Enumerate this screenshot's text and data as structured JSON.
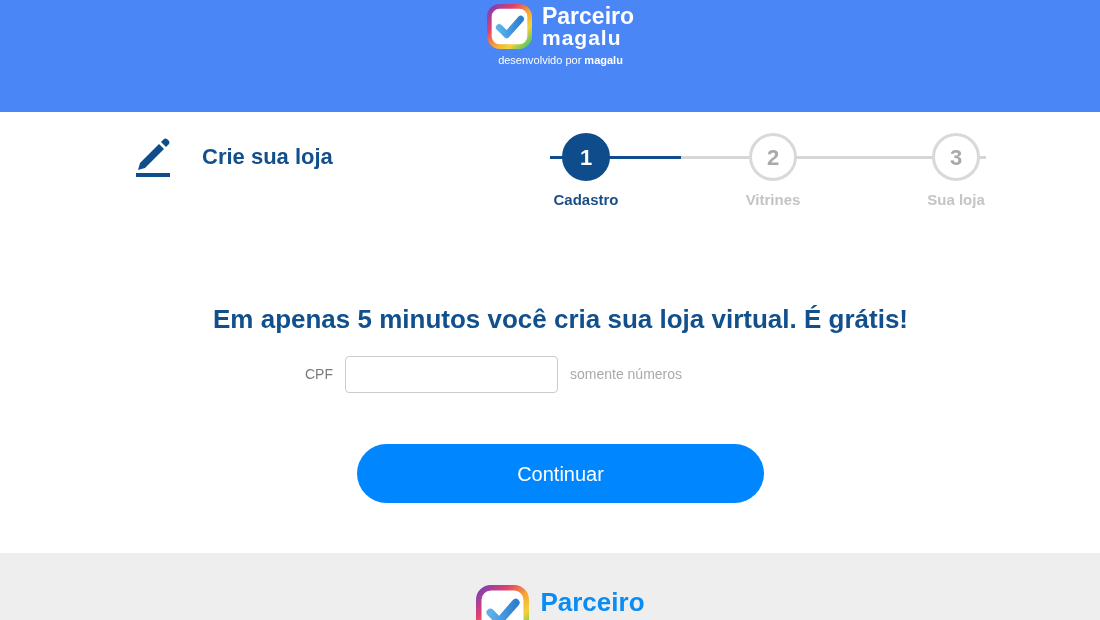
{
  "header": {
    "logo": {
      "name": "Parceiro",
      "wordmark": "magalu"
    },
    "tagline": "desenvolvido por **magalu**"
  },
  "page_title": "Crie sua loja",
  "stepper": {
    "level": 0.3,
    "steps": [
      {
        "number": "1",
        "label": "Cadastro",
        "selected": true
      },
      {
        "number": "2",
        "label": "Vitrines",
        "selected": false
      },
      {
        "number": "3",
        "label": "Sua loja",
        "selected": false
      }
    ]
  },
  "form": {
    "headline": "Em apenas 5 minutos você cria sua loja virtual. É grátis!",
    "fields": [
      {
        "label": "CPF",
        "help_text": "somente números"
      }
    ],
    "submit_button": "Continuar"
  },
  "footer": {
    "logo": {
      "name": "Parceiro"
    }
  }
}
